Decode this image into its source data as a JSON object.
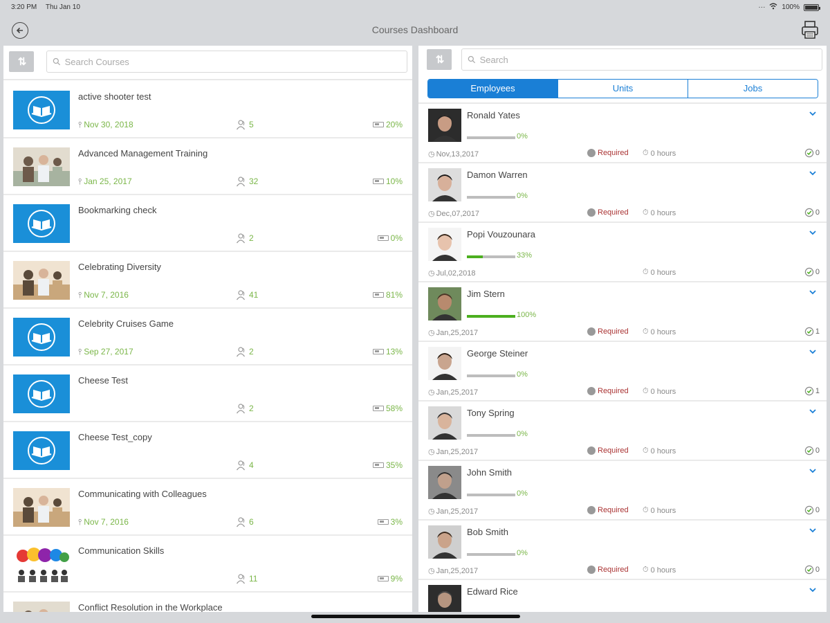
{
  "status_bar": {
    "time": "3:20 PM",
    "date": "Thu Jan 10",
    "battery": "100%"
  },
  "header": {
    "title": "Courses Dashboard"
  },
  "courses_panel": {
    "search_placeholder": "Search Courses",
    "courses": [
      {
        "title": "active shooter test",
        "date": "Nov 30, 2018",
        "count": "5",
        "percent": "20%",
        "thumb": "book-icon"
      },
      {
        "title": "Advanced Management Training",
        "date": "Jan 25, 2017",
        "count": "32",
        "percent": "10%",
        "thumb": "photo"
      },
      {
        "title": "Bookmarking check",
        "date": "",
        "count": "2",
        "percent": "0%",
        "thumb": "book-icon"
      },
      {
        "title": "Celebrating Diversity",
        "date": "Nov 7, 2016",
        "count": "41",
        "percent": "81%",
        "thumb": "photo"
      },
      {
        "title": "Celebrity Cruises Game",
        "date": "Sep 27, 2017",
        "count": "2",
        "percent": "13%",
        "thumb": "book-icon"
      },
      {
        "title": "Cheese Test",
        "date": "",
        "count": "2",
        "percent": "58%",
        "thumb": "book-icon"
      },
      {
        "title": "Cheese Test_copy",
        "date": "",
        "count": "4",
        "percent": "35%",
        "thumb": "book-icon"
      },
      {
        "title": "Communicating with Colleagues",
        "date": "Nov 7, 2016",
        "count": "6",
        "percent": "3%",
        "thumb": "photo"
      },
      {
        "title": "Communication Skills",
        "date": "",
        "count": "11",
        "percent": "9%",
        "thumb": "speech-bubbles"
      },
      {
        "title": "Conflict Resolution in the Workplace",
        "date": "",
        "count": "",
        "percent": "",
        "thumb": "photo"
      }
    ]
  },
  "employees_panel": {
    "search_placeholder": "Search",
    "tabs": [
      "Employees",
      "Units",
      "Jobs"
    ],
    "active_tab": "Employees",
    "employees": [
      {
        "name": "Ronald Yates",
        "progress": 0,
        "progress_text": "0%",
        "date": "Nov,13,2017",
        "required": "Required",
        "hours": "0 hours",
        "completed": "0"
      },
      {
        "name": "Damon Warren",
        "progress": 0,
        "progress_text": "0%",
        "date": "Dec,07,2017",
        "required": "Required",
        "hours": "0 hours",
        "completed": "0"
      },
      {
        "name": "Popi Vouzounara",
        "progress": 33,
        "progress_text": "33%",
        "date": "Jul,02,2018",
        "required": "",
        "hours": "0 hours",
        "completed": "0"
      },
      {
        "name": "Jim Stern",
        "progress": 100,
        "progress_text": "100%",
        "date": "Jan,25,2017",
        "required": "Required",
        "hours": "0 hours",
        "completed": "1"
      },
      {
        "name": "George Steiner",
        "progress": 0,
        "progress_text": "0%",
        "date": "Jan,25,2017",
        "required": "Required",
        "hours": "0 hours",
        "completed": "1"
      },
      {
        "name": "Tony Spring",
        "progress": 0,
        "progress_text": "0%",
        "date": "Jan,25,2017",
        "required": "Required",
        "hours": "0 hours",
        "completed": "0"
      },
      {
        "name": "John Smith",
        "progress": 0,
        "progress_text": "0%",
        "date": "Jan,25,2017",
        "required": "Required",
        "hours": "0 hours",
        "completed": "0"
      },
      {
        "name": "Bob Smith",
        "progress": 0,
        "progress_text": "0%",
        "date": "Jan,25,2017",
        "required": "Required",
        "hours": "0 hours",
        "completed": "0"
      },
      {
        "name": "Edward Rice",
        "progress": 0,
        "progress_text": "",
        "date": "",
        "required": "",
        "hours": "",
        "completed": ""
      }
    ]
  },
  "colors": {
    "accent": "#1a7fd6",
    "progress_green": "#7ab648",
    "required_red": "#aa3333",
    "course_blue": "#1a8fd8"
  }
}
